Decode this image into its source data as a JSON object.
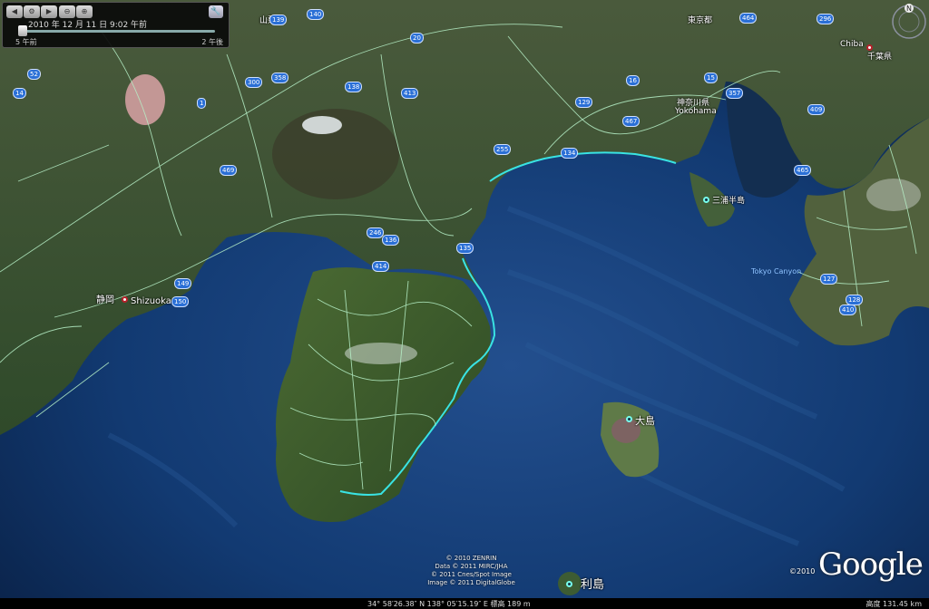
{
  "time_slider": {
    "date_text": "2010 年 12 月 11 日   9:02 午前",
    "left_label": "5 午前",
    "right_label": "2 午後"
  },
  "compass": {
    "north": "N"
  },
  "places": {
    "shizuoka_jp": "静岡",
    "shizuoka_en": "Shizuoka",
    "yokohama": "Yokohama",
    "kanagawa": "神奈川県",
    "tokyo": "東京都",
    "yamanashi": "山梨県",
    "chiba_en": "Chiba",
    "chiba_jp": "千葉県",
    "miura": "三浦半島",
    "oshima": "大島",
    "toshima": "利島",
    "tokyo_canyon": "Tokyo Canyon"
  },
  "routes": [
    "52",
    "139",
    "140",
    "20",
    "300",
    "358",
    "469",
    "1",
    "138",
    "413",
    "135",
    "136",
    "246",
    "414",
    "149",
    "150",
    "255",
    "134",
    "129",
    "467",
    "16",
    "15",
    "357",
    "409",
    "465",
    "127",
    "128",
    "410",
    "464",
    "296",
    "14",
    "51",
    "139",
    "411"
  ],
  "attribution": [
    "© 2010 ZENRIN",
    "Data © 2011 MIRC/JHA",
    "© 2011 Cnes/Spot Image",
    "Image © 2011 DigitalGlobe"
  ],
  "status": {
    "coords": "34° 58′26.38″ N   138° 05′15.19″ E  標高  189 m",
    "altitude": "高度    131.45 km"
  },
  "copyright": "©2010",
  "logo": "Google",
  "colors": {
    "ocean": "#0b2a55",
    "land": "#3c5a2c",
    "road": "#b7f1c8",
    "coast": "#39e3e3"
  }
}
